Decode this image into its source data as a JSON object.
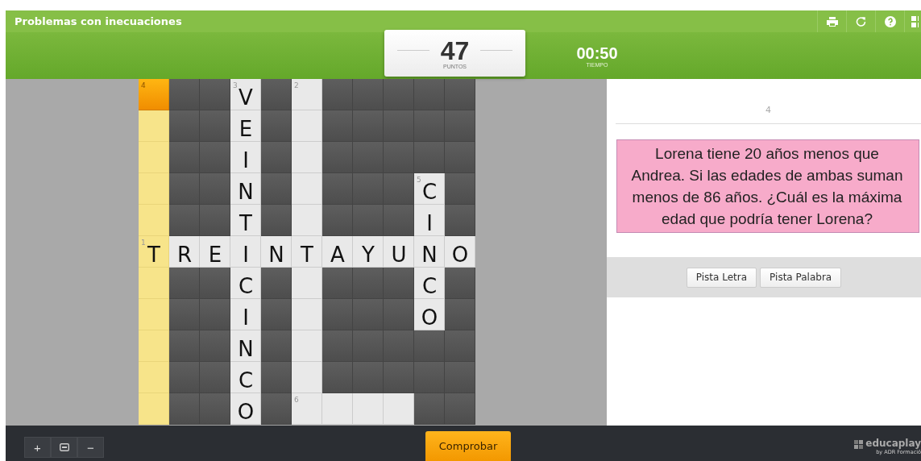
{
  "window": {
    "title": "Problemas con inecuaciones"
  },
  "score": {
    "value": "47",
    "label": "PUNTOS"
  },
  "timer": {
    "value": "00:50",
    "label": "TIEMPO"
  },
  "grid": [
    [
      {
        "kind": "cursor",
        "number": "4"
      },
      {
        "kind": "block"
      },
      {
        "kind": "block"
      },
      {
        "kind": "open",
        "letter": "V",
        "number": "3"
      },
      {
        "kind": "block"
      },
      {
        "kind": "open",
        "number": "2"
      },
      {
        "kind": "block"
      },
      {
        "kind": "block"
      },
      {
        "kind": "block"
      },
      {
        "kind": "block"
      },
      {
        "kind": "block"
      }
    ],
    [
      {
        "kind": "active"
      },
      {
        "kind": "block"
      },
      {
        "kind": "block"
      },
      {
        "kind": "open",
        "letter": "E"
      },
      {
        "kind": "block"
      },
      {
        "kind": "open"
      },
      {
        "kind": "block"
      },
      {
        "kind": "block"
      },
      {
        "kind": "block"
      },
      {
        "kind": "block"
      },
      {
        "kind": "block"
      }
    ],
    [
      {
        "kind": "active"
      },
      {
        "kind": "block"
      },
      {
        "kind": "block"
      },
      {
        "kind": "open",
        "letter": "I"
      },
      {
        "kind": "block"
      },
      {
        "kind": "open"
      },
      {
        "kind": "block"
      },
      {
        "kind": "block"
      },
      {
        "kind": "block"
      },
      {
        "kind": "block"
      },
      {
        "kind": "block"
      }
    ],
    [
      {
        "kind": "active"
      },
      {
        "kind": "block"
      },
      {
        "kind": "block"
      },
      {
        "kind": "open",
        "letter": "N"
      },
      {
        "kind": "block"
      },
      {
        "kind": "open"
      },
      {
        "kind": "block"
      },
      {
        "kind": "block"
      },
      {
        "kind": "block"
      },
      {
        "kind": "open",
        "letter": "C",
        "number": "5"
      },
      {
        "kind": "block"
      }
    ],
    [
      {
        "kind": "active"
      },
      {
        "kind": "block"
      },
      {
        "kind": "block"
      },
      {
        "kind": "open",
        "letter": "T"
      },
      {
        "kind": "block"
      },
      {
        "kind": "open"
      },
      {
        "kind": "block"
      },
      {
        "kind": "block"
      },
      {
        "kind": "block"
      },
      {
        "kind": "open",
        "letter": "I"
      },
      {
        "kind": "block"
      }
    ],
    [
      {
        "kind": "active",
        "letter": "T",
        "number": "1"
      },
      {
        "kind": "open",
        "letter": "R"
      },
      {
        "kind": "open",
        "letter": "E"
      },
      {
        "kind": "open",
        "letter": "I"
      },
      {
        "kind": "open",
        "letter": "N"
      },
      {
        "kind": "open",
        "letter": "T"
      },
      {
        "kind": "open",
        "letter": "A"
      },
      {
        "kind": "open",
        "letter": "Y"
      },
      {
        "kind": "open",
        "letter": "U"
      },
      {
        "kind": "open",
        "letter": "N"
      },
      {
        "kind": "open",
        "letter": "O"
      }
    ],
    [
      {
        "kind": "active"
      },
      {
        "kind": "block"
      },
      {
        "kind": "block"
      },
      {
        "kind": "open",
        "letter": "C"
      },
      {
        "kind": "block"
      },
      {
        "kind": "open"
      },
      {
        "kind": "block"
      },
      {
        "kind": "block"
      },
      {
        "kind": "block"
      },
      {
        "kind": "open",
        "letter": "C"
      },
      {
        "kind": "block"
      }
    ],
    [
      {
        "kind": "active"
      },
      {
        "kind": "block"
      },
      {
        "kind": "block"
      },
      {
        "kind": "open",
        "letter": "I"
      },
      {
        "kind": "block"
      },
      {
        "kind": "open"
      },
      {
        "kind": "block"
      },
      {
        "kind": "block"
      },
      {
        "kind": "block"
      },
      {
        "kind": "open",
        "letter": "O"
      },
      {
        "kind": "block"
      }
    ],
    [
      {
        "kind": "active"
      },
      {
        "kind": "block"
      },
      {
        "kind": "block"
      },
      {
        "kind": "open",
        "letter": "N"
      },
      {
        "kind": "block"
      },
      {
        "kind": "open"
      },
      {
        "kind": "block"
      },
      {
        "kind": "block"
      },
      {
        "kind": "block"
      },
      {
        "kind": "block"
      },
      {
        "kind": "block"
      }
    ],
    [
      {
        "kind": "active"
      },
      {
        "kind": "block"
      },
      {
        "kind": "block"
      },
      {
        "kind": "open",
        "letter": "C"
      },
      {
        "kind": "block"
      },
      {
        "kind": "open"
      },
      {
        "kind": "block"
      },
      {
        "kind": "block"
      },
      {
        "kind": "block"
      },
      {
        "kind": "block"
      },
      {
        "kind": "block"
      }
    ],
    [
      {
        "kind": "active"
      },
      {
        "kind": "block"
      },
      {
        "kind": "block"
      },
      {
        "kind": "open",
        "letter": "O"
      },
      {
        "kind": "block"
      },
      {
        "kind": "open",
        "number": "6"
      },
      {
        "kind": "open"
      },
      {
        "kind": "open"
      },
      {
        "kind": "open"
      },
      {
        "kind": "block"
      },
      {
        "kind": "block"
      }
    ]
  ],
  "clue": {
    "number": "4",
    "text": "Lorena tiene 20 años menos que Andrea. Si las edades de ambas suman menos de 86 años. ¿Cuál es la máxima edad que podría tener Lorena?"
  },
  "hint_buttons": [
    "Pista Letra",
    "Pista Palabra"
  ],
  "zoom_buttons": [
    {
      "kind": "text",
      "label": "+"
    },
    {
      "kind": "icon"
    },
    {
      "kind": "text",
      "label": "−"
    }
  ],
  "check_button": "Comprobar",
  "logo": {
    "name": "educaplay",
    "byline": "by ADR Formació"
  }
}
